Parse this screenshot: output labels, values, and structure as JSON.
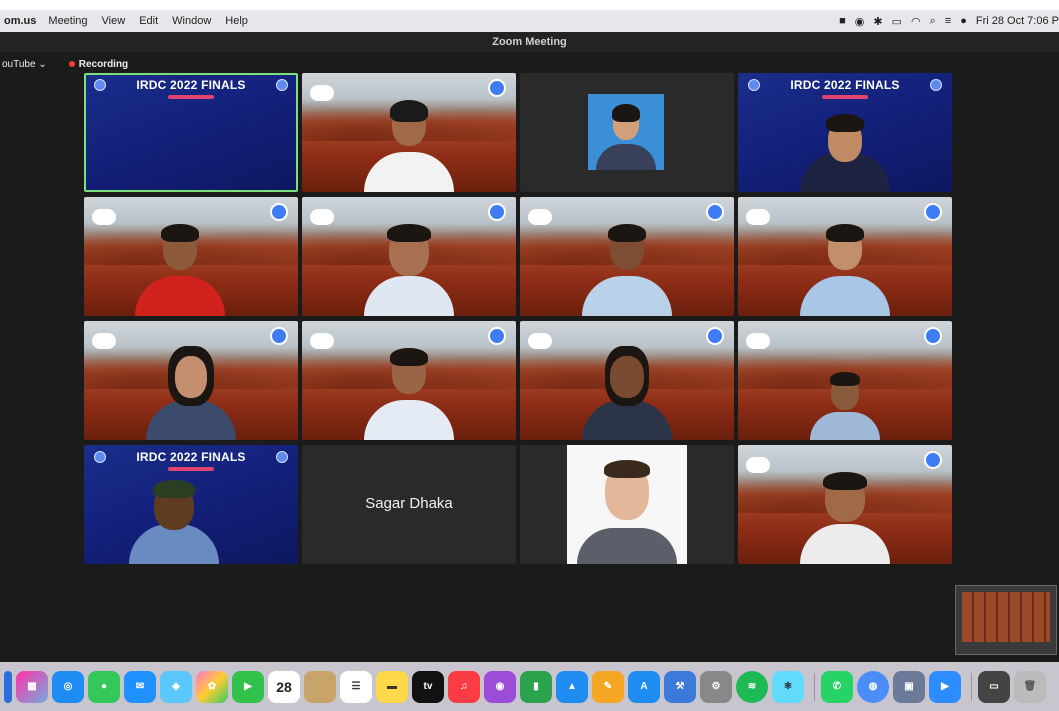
{
  "menubar": {
    "app": "om.us",
    "items": [
      "Meeting",
      "View",
      "Edit",
      "Window",
      "Help"
    ],
    "datetime": "Fri 28 Oct 7:06 P"
  },
  "window": {
    "title": "Zoom Meeting",
    "toolbar": {
      "youtube_label": "ouTube",
      "youtube_chevron": "⌄",
      "recording_label": "Recording"
    }
  },
  "tiles": {
    "r1c1": {
      "title": "IRDC 2022 FINALS"
    },
    "r1c4": {
      "title": "IRDC 2022 FINALS"
    },
    "r4c1": {
      "title": "IRDC 2022 FINALS"
    },
    "r4c2": {
      "name": "Sagar Dhaka"
    }
  },
  "dock": {
    "calendar_day": "28",
    "tv_label": "tv"
  },
  "colors": {
    "recording_dot": "#ff3b30",
    "active_speaker_border": "#7be07b"
  }
}
